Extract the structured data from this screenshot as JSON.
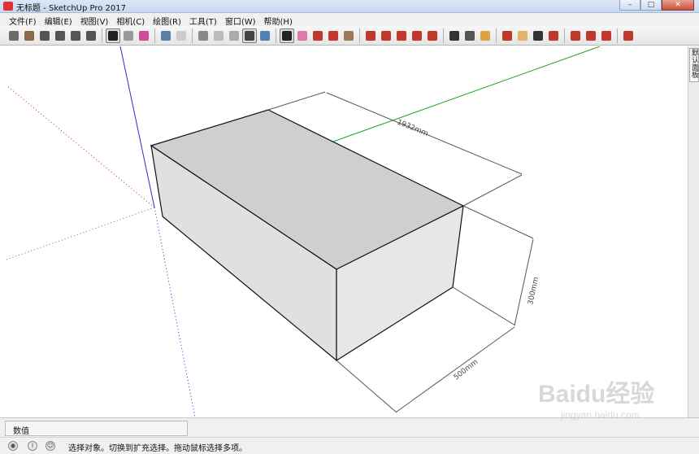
{
  "window": {
    "title": "无标题 - SketchUp Pro 2017"
  },
  "menu": [
    "文件(F)",
    "编辑(E)",
    "视图(V)",
    "相机(C)",
    "绘图(R)",
    "工具(T)",
    "窗口(W)",
    "帮助(H)"
  ],
  "toolbar": {
    "groups": [
      [
        {
          "name": "3d-warehouse-icon",
          "color": "#6b6b6b"
        },
        {
          "name": "component-icon",
          "color": "#8a6a4a"
        },
        {
          "name": "view-iso-icon",
          "color": "#555"
        },
        {
          "name": "view-top-icon",
          "color": "#555"
        },
        {
          "name": "view-front-icon",
          "color": "#555"
        },
        {
          "name": "view-right-icon",
          "color": "#555"
        }
      ],
      [
        {
          "name": "select-arrow-icon",
          "color": "#222",
          "active": true
        },
        {
          "name": "make-component-icon",
          "color": "#9a9a9a"
        },
        {
          "name": "paint-bucket-icon",
          "color": "#d24a9c"
        }
      ],
      [
        {
          "name": "xray-icon",
          "color": "#5a7fa8"
        },
        {
          "name": "back-edges-icon",
          "color": "#cccccc"
        }
      ],
      [
        {
          "name": "wireframe-icon",
          "color": "#888"
        },
        {
          "name": "hidden-line-icon",
          "color": "#bbb"
        },
        {
          "name": "shaded-icon",
          "color": "#aaa"
        },
        {
          "name": "shaded-textures-icon",
          "color": "#444",
          "active": true
        },
        {
          "name": "monochrome-icon",
          "color": "#4f82b0"
        }
      ],
      [
        {
          "name": "select-tool-icon",
          "color": "#222",
          "active": true
        },
        {
          "name": "eraser-icon",
          "color": "#e07aa8"
        },
        {
          "name": "pencil-line-icon",
          "color": "#c0392b"
        },
        {
          "name": "arc-icon",
          "color": "#c0392b"
        },
        {
          "name": "rectangle-icon",
          "color": "#9a7b55"
        }
      ],
      [
        {
          "name": "push-pull-icon",
          "color": "#c0392b"
        },
        {
          "name": "follow-me-icon",
          "color": "#c0392b"
        },
        {
          "name": "move-icon",
          "color": "#c0392b"
        },
        {
          "name": "rotate-icon",
          "color": "#c0392b"
        },
        {
          "name": "scale-icon",
          "color": "#c0392b"
        }
      ],
      [
        {
          "name": "tape-measure-icon",
          "color": "#333"
        },
        {
          "name": "text-label-icon",
          "color": "#555"
        },
        {
          "name": "protractor-icon",
          "color": "#d9a441"
        }
      ],
      [
        {
          "name": "orbit-icon",
          "color": "#c0392b"
        },
        {
          "name": "pan-icon",
          "color": "#e0b46a"
        },
        {
          "name": "zoom-icon",
          "color": "#333"
        },
        {
          "name": "zoom-extents-icon",
          "color": "#c0392b"
        }
      ],
      [
        {
          "name": "warehouse-get-icon",
          "color": "#c0392b"
        },
        {
          "name": "extension-warehouse-icon",
          "color": "#c0392b"
        },
        {
          "name": "send-to-layout-icon",
          "color": "#c0392b"
        }
      ],
      [
        {
          "name": "ruby-console-icon",
          "color": "#c0392b"
        }
      ]
    ]
  },
  "viewport": {
    "dimension_length": "1932mm",
    "dimension_height": "300mm",
    "dimension_width": "500mm"
  },
  "tray": {
    "tab_label": "默认面板"
  },
  "measurements": {
    "label": "数值"
  },
  "status": {
    "text": "选择对象。切换到扩充选择。拖动鼠标选择多项。"
  },
  "watermark": {
    "brand": "Baidu经验",
    "url": "jingyan.baidu.com"
  }
}
